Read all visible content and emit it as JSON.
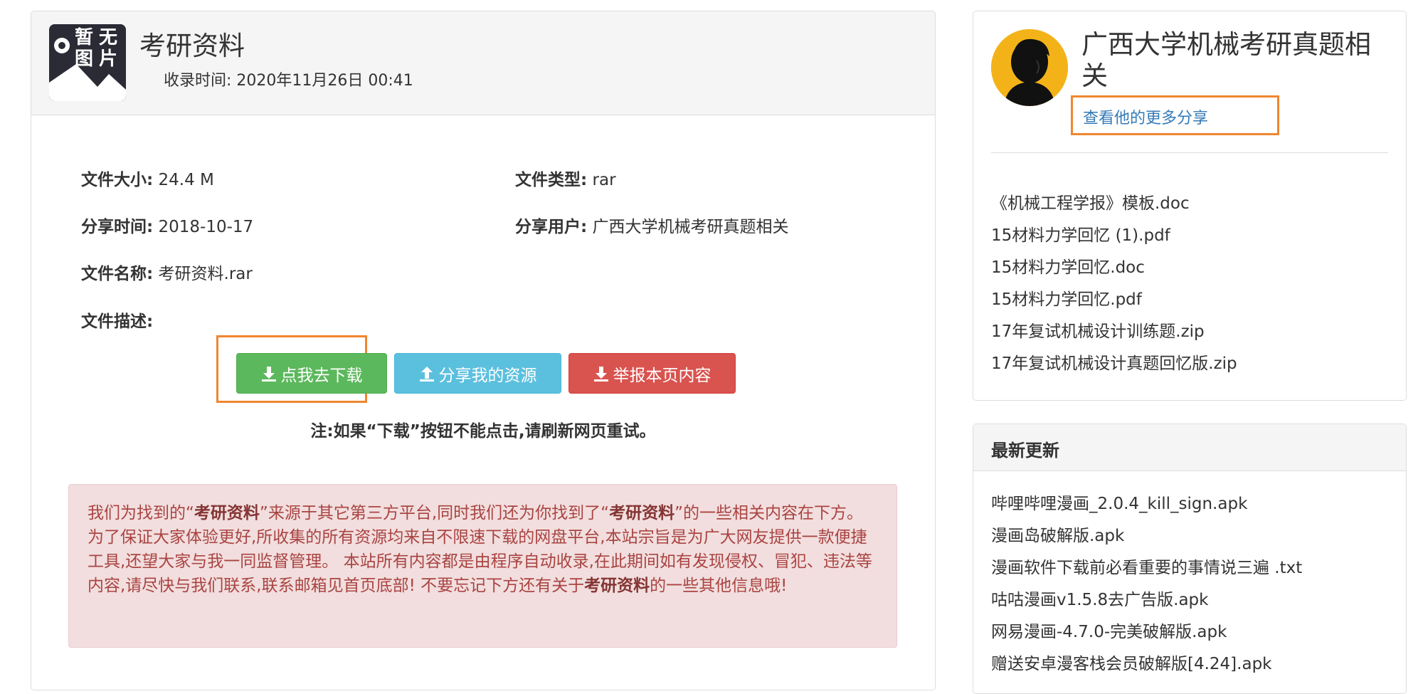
{
  "file": {
    "title": "考研资料",
    "thumb_text": [
      "暂",
      "无",
      "图",
      "片"
    ],
    "collected_label": "收录时间:",
    "collected_value": "2020年11月26日 00:41",
    "size_label": "文件大小:",
    "size_value": "24.4 M",
    "type_label": "文件类型:",
    "type_value": "rar",
    "share_time_label": "分享时间:",
    "share_time_value": "2018-10-17",
    "share_user_label": "分享用户:",
    "share_user_value": "广西大学机械考研真题相关",
    "name_label": "文件名称:",
    "name_value": "考研资料.rar",
    "desc_label": "文件描述:"
  },
  "buttons": {
    "download": "点我去下载",
    "share": "分享我的资源",
    "report": "举报本页内容"
  },
  "note": "注:如果“下载”按钮不能点击,请刷新网页重试。",
  "alert": {
    "p1": "我们为找到的“",
    "k1": "考研资料",
    "p2": "”来源于其它第三方平台,同时我们还为你找到了“",
    "k2": "考研资料",
    "p3": "”的一些相关内容在下方。 为了保证大家体验更好,所收集的所有资源均来自不限速下载的网盘平台,本站宗旨是为广大网友提供一款便捷工具,还望大家与我一同监督管理。 本站所有内容都是由程序自动收录,在此期间如有发现侵权、冒犯、违法等内容,请尽快与我们联系,联系邮箱见首页底部! 不要忘记下方还有关于",
    "k3": "考研资料",
    "p4": "的一些其他信息哦!"
  },
  "author": {
    "name": "广西大学机械考研真题相关",
    "more_link": "查看他的更多分享",
    "files": [
      "《机械工程学报》模板.doc",
      "15材料力学回忆 (1).pdf",
      "15材料力学回忆.doc",
      "15材料力学回忆.pdf",
      "17年复试机械设计训练题.zip",
      "17年复试机械设计真题回忆版.zip"
    ]
  },
  "latest": {
    "title": "最新更新",
    "files": [
      "哔哩哔哩漫画_2.0.4_kill_sign.apk",
      "漫画岛破解版.apk",
      "漫画软件下载前必看重要的事情说三遍 .txt",
      "咕咕漫画v1.5.8去广告版.apk",
      "网易漫画-4.7.0-完美破解版.apk",
      "赠送安卓漫客栈会员破解版[4.24].apk"
    ]
  },
  "colors": {
    "success": "#5cb85c",
    "info": "#5bc0de",
    "danger": "#d9534f",
    "highlight": "#f0862f",
    "link": "#337ab7",
    "alert_bg": "#f2dede",
    "alert_text": "#a94442"
  },
  "icons": [
    "download-icon",
    "upload-icon",
    "avatar-silhouette-icon",
    "no-image-icon"
  ]
}
